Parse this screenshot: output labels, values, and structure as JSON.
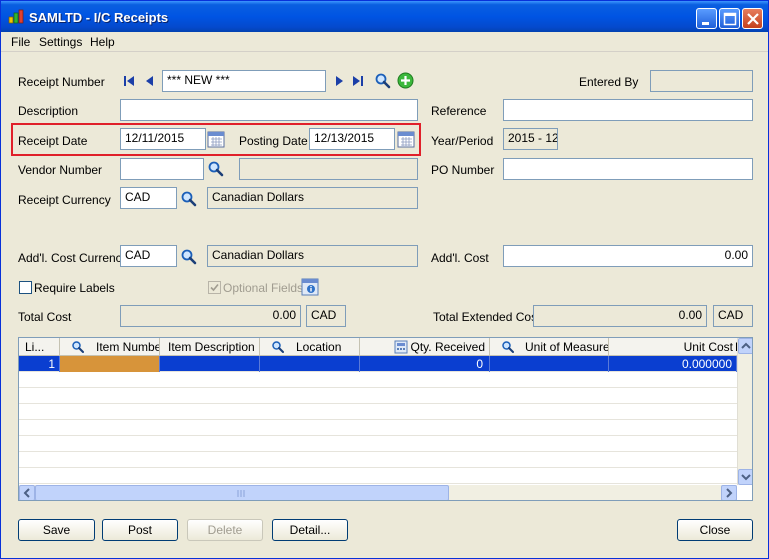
{
  "window": {
    "title": "SAMLTD - I/C Receipts"
  },
  "menu": {
    "file": "File",
    "settings": "Settings",
    "help": "Help"
  },
  "form": {
    "receipt_number_label": "Receipt Number",
    "receipt_number_value": "*** NEW ***",
    "entered_by_label": "Entered By",
    "entered_by_value": "",
    "description_label": "Description",
    "description_value": "",
    "reference_label": "Reference",
    "reference_value": "",
    "receipt_date_label": "Receipt Date",
    "receipt_date_value": "12/11/2015",
    "posting_date_label": "Posting Date",
    "posting_date_value": "12/13/2015",
    "year_period_label": "Year/Period",
    "year_period_value": "2015 - 12",
    "vendor_number_label": "Vendor Number",
    "vendor_number_value": "",
    "vendor_name_value": "",
    "po_number_label": "PO Number",
    "po_number_value": "",
    "receipt_currency_label": "Receipt Currency",
    "receipt_currency_code": "CAD",
    "receipt_currency_name": "Canadian Dollars",
    "addl_cost_currency_label": "Add'l. Cost Currency",
    "addl_cost_currency_code": "CAD",
    "addl_cost_currency_name": "Canadian Dollars",
    "addl_cost_label": "Add'l. Cost",
    "addl_cost_value": "0.00",
    "require_labels_label": "Require Labels",
    "require_labels_checked": false,
    "optional_fields_label": "Optional Fields",
    "optional_fields_checked": true,
    "total_cost_label": "Total Cost",
    "total_cost_value": "0.00",
    "total_cost_currency": "CAD",
    "total_extended_cost_label": "Total Extended Cost",
    "total_extended_cost_value": "0.00",
    "total_extended_cost_currency": "CAD"
  },
  "grid": {
    "columns": [
      "Li...",
      "Item Number",
      "Item Description",
      "Location",
      "Qty. Received",
      "Unit of Measure",
      "Unit Cost",
      "E"
    ],
    "rows": [
      {
        "line": "1",
        "item_number": "",
        "item_description": "",
        "location": "",
        "qty_received": "0",
        "unit_of_measure": "",
        "unit_cost": "0.000000"
      }
    ]
  },
  "buttons": {
    "save": "Save",
    "post": "Post",
    "delete": "Delete",
    "detail": "Detail...",
    "close": "Close"
  },
  "colors": {
    "title_bar": "#0054e3",
    "highlight_border": "#e0202a",
    "selected_row": "#0a3ed0",
    "item_cell_highlight": "#d7943a"
  }
}
